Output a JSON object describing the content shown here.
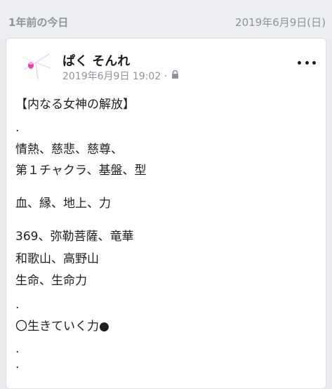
{
  "memory": {
    "title": "1年前の今日",
    "date": "2019年6月9日(日)"
  },
  "post": {
    "author": "ぱく そんれ",
    "timestamp": "2019年6月9日 19:02 ·",
    "privacy_icon": "lock-icon",
    "lines": [
      "【内なる女神の解放】",
      ".",
      "情熱、慈悲、慈尊、",
      "第１チャクラ、基盤、型",
      "血、縁、地上、力",
      "369、弥勒菩薩、竜華",
      "和歌山、高野山",
      "生命、生命力",
      ".",
      "〇生きていく力●",
      ".",
      "."
    ]
  },
  "colors": {
    "background": "#e9ebee",
    "card": "#ffffff",
    "muted_text": "#8d949e",
    "primary_text": "#1c1e21",
    "avatar_pink": "#e83fb1"
  }
}
